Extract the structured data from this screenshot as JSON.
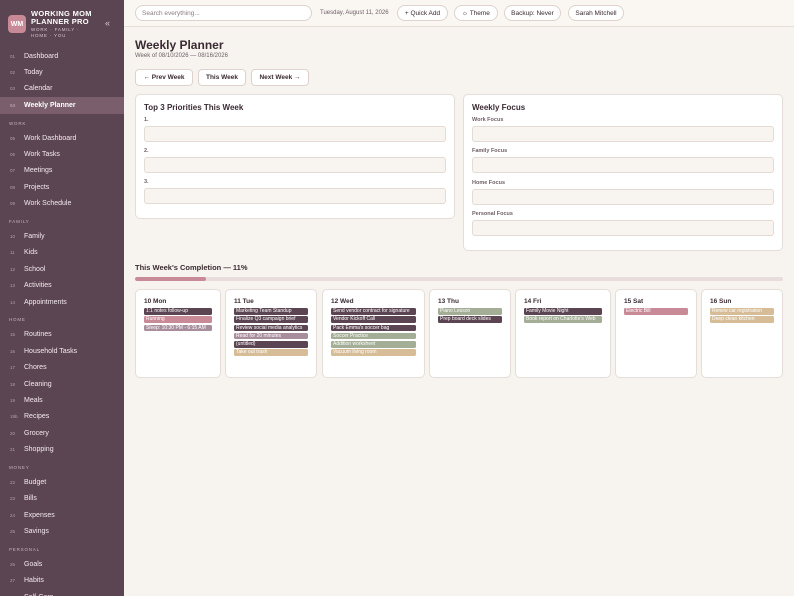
{
  "brand": {
    "logo": "WM",
    "title_line1": "WORKING MOM",
    "title_line2": "PLANNER PRO",
    "sub_line1": "WORK · FAMILY ·",
    "sub_line2": "HOME · YOU",
    "collapse": "«"
  },
  "sidebar": {
    "top": [
      {
        "num": "01",
        "label": "Dashboard"
      },
      {
        "num": "02",
        "label": "Today"
      },
      {
        "num": "03",
        "label": "Calendar"
      },
      {
        "num": "04",
        "label": "Weekly Planner",
        "active": true
      }
    ],
    "sections": [
      {
        "title": "WORK",
        "items": [
          {
            "num": "05",
            "label": "Work Dashboard"
          },
          {
            "num": "06",
            "label": "Work Tasks"
          },
          {
            "num": "07",
            "label": "Meetings"
          },
          {
            "num": "08",
            "label": "Projects"
          },
          {
            "num": "09",
            "label": "Work Schedule"
          }
        ]
      },
      {
        "title": "FAMILY",
        "items": [
          {
            "num": "10",
            "label": "Family"
          },
          {
            "num": "11",
            "label": "Kids"
          },
          {
            "num": "12",
            "label": "School"
          },
          {
            "num": "13",
            "label": "Activities"
          },
          {
            "num": "14",
            "label": "Appointments"
          }
        ]
      },
      {
        "title": "HOME",
        "items": [
          {
            "num": "15",
            "label": "Routines"
          },
          {
            "num": "16",
            "label": "Household Tasks"
          },
          {
            "num": "17",
            "label": "Chores"
          },
          {
            "num": "18",
            "label": "Cleaning"
          },
          {
            "num": "19",
            "label": "Meals"
          },
          {
            "num": "19b",
            "label": "Recipes"
          },
          {
            "num": "20",
            "label": "Grocery"
          },
          {
            "num": "21",
            "label": "Shopping"
          }
        ]
      },
      {
        "title": "MONEY",
        "items": [
          {
            "num": "22",
            "label": "Budget"
          },
          {
            "num": "23",
            "label": "Bills"
          },
          {
            "num": "24",
            "label": "Expenses"
          },
          {
            "num": "25",
            "label": "Savings"
          }
        ]
      },
      {
        "title": "PERSONAL",
        "items": [
          {
            "num": "26",
            "label": "Goals"
          },
          {
            "num": "27",
            "label": "Habits"
          },
          {
            "num": "28",
            "label": "Self-Care"
          }
        ]
      }
    ]
  },
  "topbar": {
    "search_placeholder": "Search everything...",
    "date": "Tuesday, August 11, 2026",
    "quick_add": "+ Quick Add",
    "theme": "☼ Theme",
    "backup": "Backup: Never",
    "user": "Sarah Mitchell"
  },
  "page": {
    "title": "Weekly Planner",
    "subtitle": "Week of 08/10/2026 — 08/16/2026",
    "prev": "← Prev Week",
    "this": "This Week",
    "next": "Next Week →"
  },
  "priorities": {
    "title": "Top 3 Priorities This Week",
    "labels": [
      "1.",
      "2.",
      "3."
    ]
  },
  "focus": {
    "title": "Weekly Focus",
    "labels": [
      "Work Focus",
      "Family Focus",
      "Home Focus",
      "Personal Focus"
    ]
  },
  "completion": {
    "label": "This Week's Completion — 11%",
    "percent": 11
  },
  "colors": {
    "dark": "#5c4552",
    "rose": "#c98a98",
    "mauve": "#a88e9c",
    "sage": "#a4ad95",
    "tan": "#d6bd98"
  },
  "days": [
    {
      "label": "10 Mon",
      "tasks": [
        {
          "text": "1:1 notes follow-up",
          "color": "dark"
        },
        {
          "text": "Running",
          "color": "rose"
        },
        {
          "text": "Sleep: 10:30 PM - 6:15 AM",
          "color": "mauve"
        }
      ]
    },
    {
      "label": "11 Tue",
      "tasks": [
        {
          "text": "Marketing Team Standup",
          "color": "dark"
        },
        {
          "text": "Finalize Q3 campaign brief",
          "color": "dark"
        },
        {
          "text": "Review social media analytics",
          "color": "dark"
        },
        {
          "text": "Read for 20 minutes",
          "color": "mauve"
        },
        {
          "text": "(untitled)",
          "color": "dark"
        },
        {
          "text": "Take out trash",
          "color": "tan"
        }
      ]
    },
    {
      "label": "12 Wed",
      "tasks": [
        {
          "text": "Send vendor contract for signature",
          "color": "dark"
        },
        {
          "text": "Vendor Kickoff Call",
          "color": "dark"
        },
        {
          "text": "Pack Emma's soccer bag",
          "color": "dark"
        },
        {
          "text": "Soccer Practice",
          "color": "sage"
        },
        {
          "text": "Addition worksheet",
          "color": "sage"
        },
        {
          "text": "Vacuum living room",
          "color": "tan"
        }
      ]
    },
    {
      "label": "13 Thu",
      "tasks": [
        {
          "text": "Piano Lesson",
          "color": "sage"
        },
        {
          "text": "Prep board deck slides",
          "color": "dark"
        }
      ]
    },
    {
      "label": "14 Fri",
      "tasks": [
        {
          "text": "Family Movie Night",
          "color": "dark"
        },
        {
          "text": "Book report on Charlotte's Web",
          "color": "sage"
        }
      ]
    },
    {
      "label": "15 Sat",
      "tasks": [
        {
          "text": "Electric Bill",
          "color": "rose"
        }
      ]
    },
    {
      "label": "16 Sun",
      "tasks": [
        {
          "text": "Renew car registration",
          "color": "tan"
        },
        {
          "text": "Deep clean kitchen",
          "color": "tan"
        }
      ]
    }
  ]
}
